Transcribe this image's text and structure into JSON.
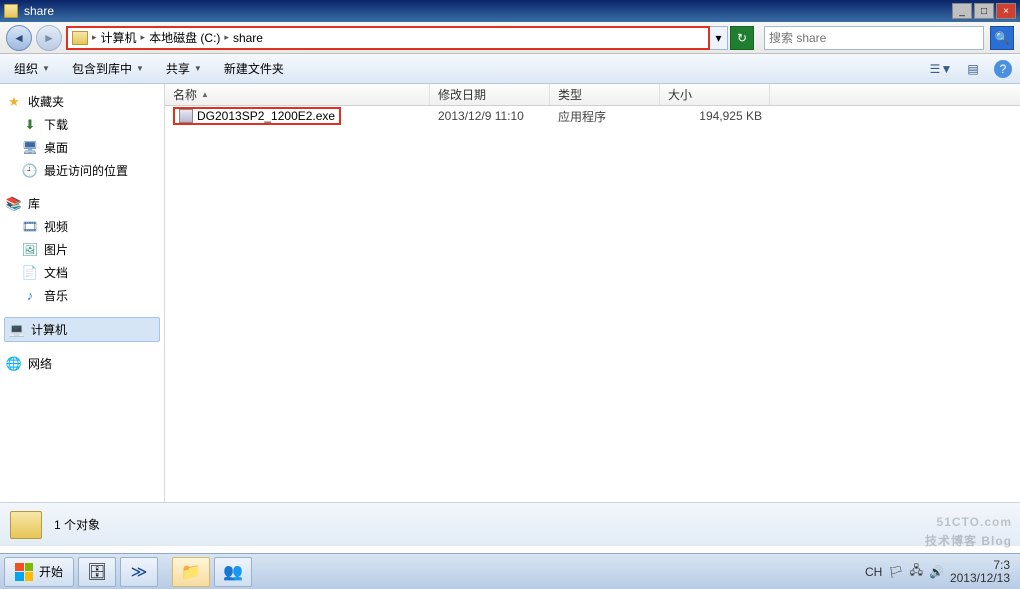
{
  "window": {
    "title": "share"
  },
  "nav": {
    "crumbs": [
      "计算机",
      "本地磁盘 (C:)",
      "share"
    ],
    "search_placeholder": "搜索 share"
  },
  "toolbar": {
    "organize": "组织",
    "include": "包含到库中",
    "share": "共享",
    "newfolder": "新建文件夹"
  },
  "sidebar": {
    "favorites": {
      "label": "收藏夹",
      "items": [
        "下载",
        "桌面",
        "最近访问的位置"
      ]
    },
    "libraries": {
      "label": "库",
      "items": [
        "视频",
        "图片",
        "文档",
        "音乐"
      ]
    },
    "computer": "计算机",
    "network": "网络"
  },
  "columns": {
    "name": "名称",
    "date": "修改日期",
    "type": "类型",
    "size": "大小"
  },
  "files": [
    {
      "name": "DG2013SP2_1200E2.exe",
      "date": "2013/12/9 11:10",
      "type": "应用程序",
      "size": "194,925 KB"
    }
  ],
  "status": {
    "count_text": "1 个对象"
  },
  "taskbar": {
    "start": "开始",
    "lang": "CH",
    "time": "7:3",
    "date": "2013/12/13"
  },
  "watermark": {
    "line1": "51CTO.com",
    "line2": "技术博客",
    "line3": "Blog"
  }
}
